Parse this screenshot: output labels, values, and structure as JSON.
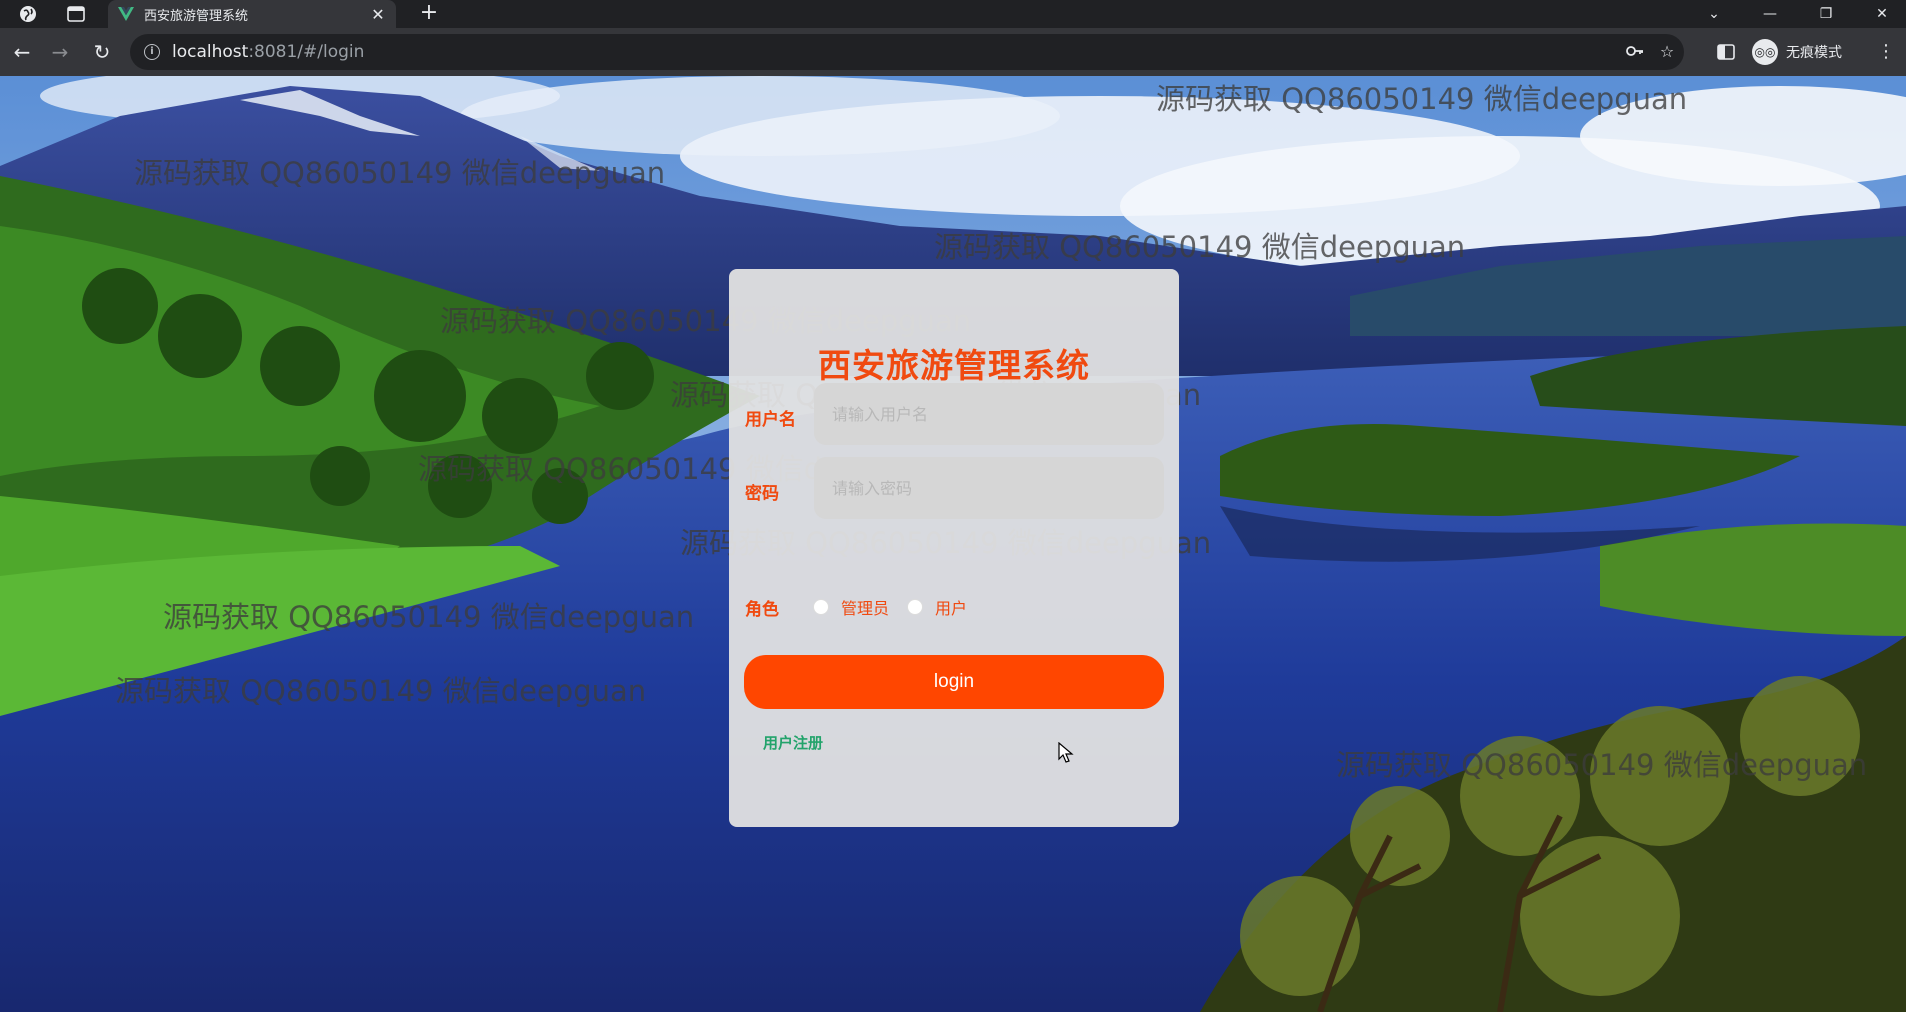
{
  "browser": {
    "tab_title": "西安旅游管理系统",
    "new_tab_symbol": "+",
    "url_host": "localhost",
    "url_rest": ":8081/#/login",
    "incognito_label": "无痕模式",
    "icons": [
      "globe-icon",
      "sidebar-icon",
      "vue-logo-icon",
      "close-icon",
      "plus-icon",
      "chevron-down-icon",
      "minimize-icon",
      "restore-icon",
      "close-window-icon",
      "back-icon",
      "forward-icon",
      "reload-icon",
      "info-icon",
      "key-icon",
      "star-icon",
      "reading-list-icon",
      "incognito-icon",
      "menu-icon"
    ]
  },
  "watermark_text": "源码获取 QQ86050149 微信deepguan",
  "login": {
    "title": "西安旅游管理系统",
    "username_label": "用户名",
    "username_placeholder": "请输入用户名",
    "password_label": "密码",
    "password_placeholder": "请输入密码",
    "role_label": "角色",
    "role_options": [
      "管理员",
      "用户"
    ],
    "login_button": "login",
    "register_link": "用户注册"
  },
  "colors": {
    "accent": "#f04a10",
    "button": "#ff4600",
    "link": "#22a36b",
    "card_bg": "#e2e2e2"
  }
}
